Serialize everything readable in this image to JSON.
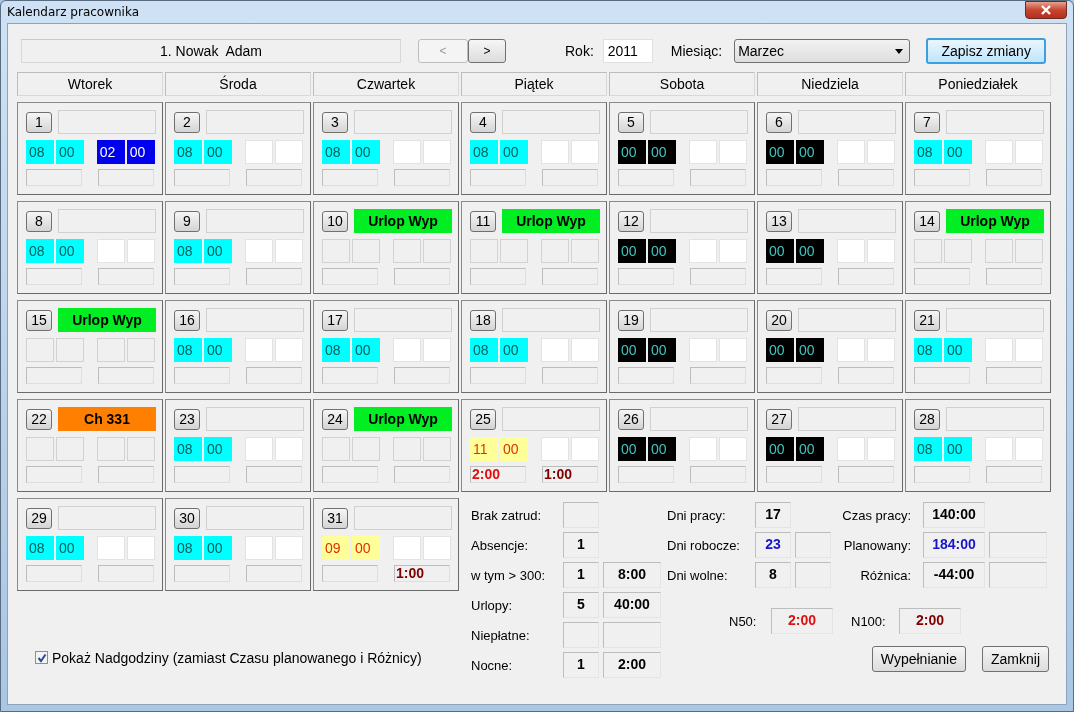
{
  "window": {
    "title": "Kalendarz pracownika"
  },
  "employee": "1. Nowak  Adam",
  "nav": {
    "prev": {
      "label": "<",
      "disabled": true
    },
    "next": {
      "label": ">",
      "disabled": false
    }
  },
  "year": {
    "label": "Rok:",
    "value": "2011"
  },
  "month": {
    "label": "Miesiąc:",
    "value": "Marzec"
  },
  "save_button": "Zapisz zmiany",
  "weekdays": [
    "Wtorek",
    "Środa",
    "Czwartek",
    "Piątek",
    "Sobota",
    "Niedziela",
    "Poniedziałek"
  ],
  "days": [
    {
      "day": "1",
      "start": {
        "kind": "work",
        "h": "08",
        "m": "00"
      },
      "end": {
        "kind": "set",
        "h": "02",
        "m": "00"
      }
    },
    {
      "day": "2",
      "start": {
        "kind": "work",
        "h": "08",
        "m": "00"
      },
      "end": {
        "kind": "empty"
      }
    },
    {
      "day": "3",
      "start": {
        "kind": "work",
        "h": "08",
        "m": "00"
      },
      "end": {
        "kind": "empty"
      }
    },
    {
      "day": "4",
      "start": {
        "kind": "work",
        "h": "08",
        "m": "00"
      },
      "end": {
        "kind": "empty"
      }
    },
    {
      "day": "5",
      "start": {
        "kind": "free",
        "h": "00",
        "m": "00"
      },
      "end": {
        "kind": "empty"
      }
    },
    {
      "day": "6",
      "start": {
        "kind": "free",
        "h": "00",
        "m": "00"
      },
      "end": {
        "kind": "empty"
      }
    },
    {
      "day": "7",
      "start": {
        "kind": "work",
        "h": "08",
        "m": "00"
      },
      "end": {
        "kind": "empty"
      }
    },
    {
      "day": "8",
      "start": {
        "kind": "work",
        "h": "08",
        "m": "00"
      },
      "end": {
        "kind": "empty"
      }
    },
    {
      "day": "9",
      "start": {
        "kind": "work",
        "h": "08",
        "m": "00"
      },
      "end": {
        "kind": "empty"
      }
    },
    {
      "day": "10",
      "tag": {
        "text": "Urlop Wyp",
        "color": "#00ee22"
      },
      "start": {
        "kind": "off"
      },
      "end": {
        "kind": "off"
      }
    },
    {
      "day": "11",
      "tag": {
        "text": "Urlop Wyp",
        "color": "#00ee22"
      },
      "start": {
        "kind": "off"
      },
      "end": {
        "kind": "off"
      }
    },
    {
      "day": "12",
      "start": {
        "kind": "free",
        "h": "00",
        "m": "00"
      },
      "end": {
        "kind": "empty"
      }
    },
    {
      "day": "13",
      "start": {
        "kind": "free",
        "h": "00",
        "m": "00"
      },
      "end": {
        "kind": "empty"
      }
    },
    {
      "day": "14",
      "tag": {
        "text": "Urlop Wyp",
        "color": "#00ee22"
      },
      "start": {
        "kind": "off"
      },
      "end": {
        "kind": "off"
      }
    },
    {
      "day": "15",
      "tag": {
        "text": "Urlop Wyp",
        "color": "#00ee22"
      },
      "start": {
        "kind": "off"
      },
      "end": {
        "kind": "off"
      }
    },
    {
      "day": "16",
      "start": {
        "kind": "work",
        "h": "08",
        "m": "00"
      },
      "end": {
        "kind": "empty"
      }
    },
    {
      "day": "17",
      "start": {
        "kind": "work",
        "h": "08",
        "m": "00"
      },
      "end": {
        "kind": "empty"
      }
    },
    {
      "day": "18",
      "start": {
        "kind": "work",
        "h": "08",
        "m": "00"
      },
      "end": {
        "kind": "empty"
      }
    },
    {
      "day": "19",
      "start": {
        "kind": "free",
        "h": "00",
        "m": "00"
      },
      "end": {
        "kind": "empty"
      }
    },
    {
      "day": "20",
      "start": {
        "kind": "free",
        "h": "00",
        "m": "00"
      },
      "end": {
        "kind": "empty"
      }
    },
    {
      "day": "21",
      "start": {
        "kind": "work",
        "h": "08",
        "m": "00"
      },
      "end": {
        "kind": "empty"
      }
    },
    {
      "day": "22",
      "tag": {
        "text": "Ch 331",
        "color": "#ff8000"
      },
      "start": {
        "kind": "off"
      },
      "end": {
        "kind": "off"
      }
    },
    {
      "day": "23",
      "start": {
        "kind": "work",
        "h": "08",
        "m": "00"
      },
      "end": {
        "kind": "empty"
      }
    },
    {
      "day": "24",
      "tag": {
        "text": "Urlop Wyp",
        "color": "#00ee22"
      },
      "start": {
        "kind": "off"
      },
      "end": {
        "kind": "off"
      }
    },
    {
      "day": "25",
      "start": {
        "kind": "overtime",
        "h": "11",
        "m": "00"
      },
      "end": {
        "kind": "empty"
      },
      "n50": "2:00",
      "n100": "1:00"
    },
    {
      "day": "26",
      "start": {
        "kind": "free",
        "h": "00",
        "m": "00"
      },
      "end": {
        "kind": "empty"
      }
    },
    {
      "day": "27",
      "start": {
        "kind": "free",
        "h": "00",
        "m": "00"
      },
      "end": {
        "kind": "empty"
      }
    },
    {
      "day": "28",
      "start": {
        "kind": "work",
        "h": "08",
        "m": "00"
      },
      "end": {
        "kind": "empty"
      }
    },
    {
      "day": "29",
      "start": {
        "kind": "work",
        "h": "08",
        "m": "00"
      },
      "end": {
        "kind": "empty"
      }
    },
    {
      "day": "30",
      "start": {
        "kind": "work",
        "h": "08",
        "m": "00"
      },
      "end": {
        "kind": "empty"
      }
    },
    {
      "day": "31",
      "start": {
        "kind": "overtime",
        "h": "09",
        "m": "00"
      },
      "end": {
        "kind": "empty"
      },
      "n100": "1:00"
    }
  ],
  "show_overtime": {
    "label": "Pokaż Nadgodziny (zamiast Czasu planowanego i Różnicy)",
    "checked": true
  },
  "stats_left": [
    {
      "label": "Brak zatrud:",
      "values": [
        {
          "kind": "empty"
        }
      ]
    },
    {
      "label": "Absencje:",
      "values": [
        {
          "kind": "value",
          "text": "1",
          "color": "#000000"
        }
      ]
    },
    {
      "label": "w tym > 300:",
      "values": [
        {
          "kind": "value",
          "text": "1",
          "color": "#000000"
        },
        {
          "kind": "value",
          "text": "8:00",
          "color": "#000000"
        }
      ]
    },
    {
      "label": "Urlopy:",
      "values": [
        {
          "kind": "value",
          "text": "5",
          "color": "#000000"
        },
        {
          "kind": "value",
          "text": "40:00",
          "color": "#000000"
        }
      ]
    },
    {
      "label": "Niepłatne:",
      "values": [
        {
          "kind": "empty"
        },
        {
          "kind": "empty"
        }
      ]
    },
    {
      "label": "Nocne:",
      "values": [
        {
          "kind": "value",
          "text": "1",
          "color": "#000000"
        },
        {
          "kind": "value",
          "text": "2:00",
          "color": "#000000"
        }
      ]
    }
  ],
  "stats_mid": [
    {
      "label": "Dni pracy:",
      "values": [
        {
          "kind": "value",
          "text": "17",
          "color": "#000000"
        }
      ]
    },
    {
      "label": "Dni robocze:",
      "values": [
        {
          "kind": "value",
          "text": "23",
          "color": "#1515c8"
        },
        {
          "kind": "empty"
        }
      ]
    },
    {
      "label": "Dni wolne:",
      "values": [
        {
          "kind": "value",
          "text": "8",
          "color": "#000000"
        },
        {
          "kind": "empty"
        }
      ]
    }
  ],
  "stats_right": [
    {
      "label": "Czas pracy:",
      "values": [
        {
          "kind": "value",
          "text": "140:00",
          "color": "#000000"
        }
      ]
    },
    {
      "label": "Planowany:",
      "values": [
        {
          "kind": "value",
          "text": "184:00",
          "color": "#1515c8"
        },
        {
          "kind": "empty"
        }
      ]
    },
    {
      "label": "Różnica:",
      "values": [
        {
          "kind": "value",
          "text": "-44:00",
          "color": "#000000"
        },
        {
          "kind": "empty"
        }
      ]
    }
  ],
  "overtime": [
    {
      "label": "N50:",
      "value": "2:00",
      "color": "#e01010"
    },
    {
      "label": "N100:",
      "value": "2:00",
      "color": "#800000"
    }
  ],
  "buttons": [
    "Wypełnianie",
    "Zamknij"
  ]
}
